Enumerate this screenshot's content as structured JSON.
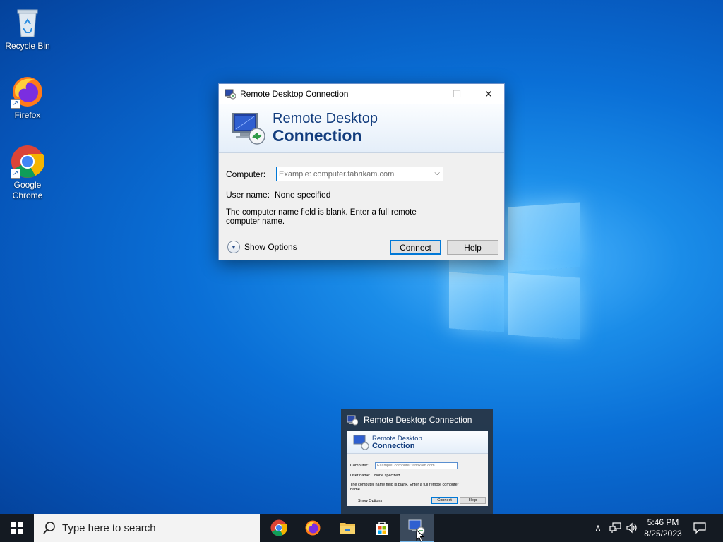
{
  "desktop": {
    "icons": [
      {
        "label": "Recycle Bin",
        "icon": "recycle-bin-icon"
      },
      {
        "label": "Firefox",
        "icon": "firefox-icon"
      },
      {
        "label": "Google Chrome",
        "icon": "chrome-icon"
      }
    ]
  },
  "dialog": {
    "title": "Remote Desktop Connection",
    "banner_line1": "Remote Desktop",
    "banner_line2": "Connection",
    "computer_label": "Computer:",
    "computer_value": "",
    "computer_placeholder": "Example: computer.fabrikam.com",
    "username_label": "User name:",
    "username_value": "None specified",
    "message": "The computer name field is blank.  Enter a full remote computer name.",
    "show_options": "Show Options",
    "connect_button": "Connect",
    "help_button": "Help"
  },
  "preview": {
    "title": "Remote Desktop Connection",
    "banner_line1": "Remote Desktop",
    "banner_line2": "Connection",
    "computer_label": "Computer:",
    "placeholder": "Example: computer.fabrikam.com",
    "username_label": "User name:",
    "username_value": "None specified",
    "message_line1": "The computer name field is blank.  Enter a full remote computer",
    "message_line2": "name.",
    "show_options": "Show Options",
    "connect": "Connect",
    "help": "Help"
  },
  "taskbar": {
    "search_placeholder": "Type here to search",
    "apps": [
      "chrome-icon",
      "firefox-icon",
      "file-explorer-icon",
      "microsoft-store-icon",
      "remote-desktop-icon"
    ],
    "active_app": "remote-desktop-icon",
    "clock_time": "5:46 PM",
    "clock_date": "8/25/2023"
  },
  "colors": {
    "accent": "#0078d7",
    "banner_text": "#123c7d",
    "taskbar": "#141a22"
  }
}
